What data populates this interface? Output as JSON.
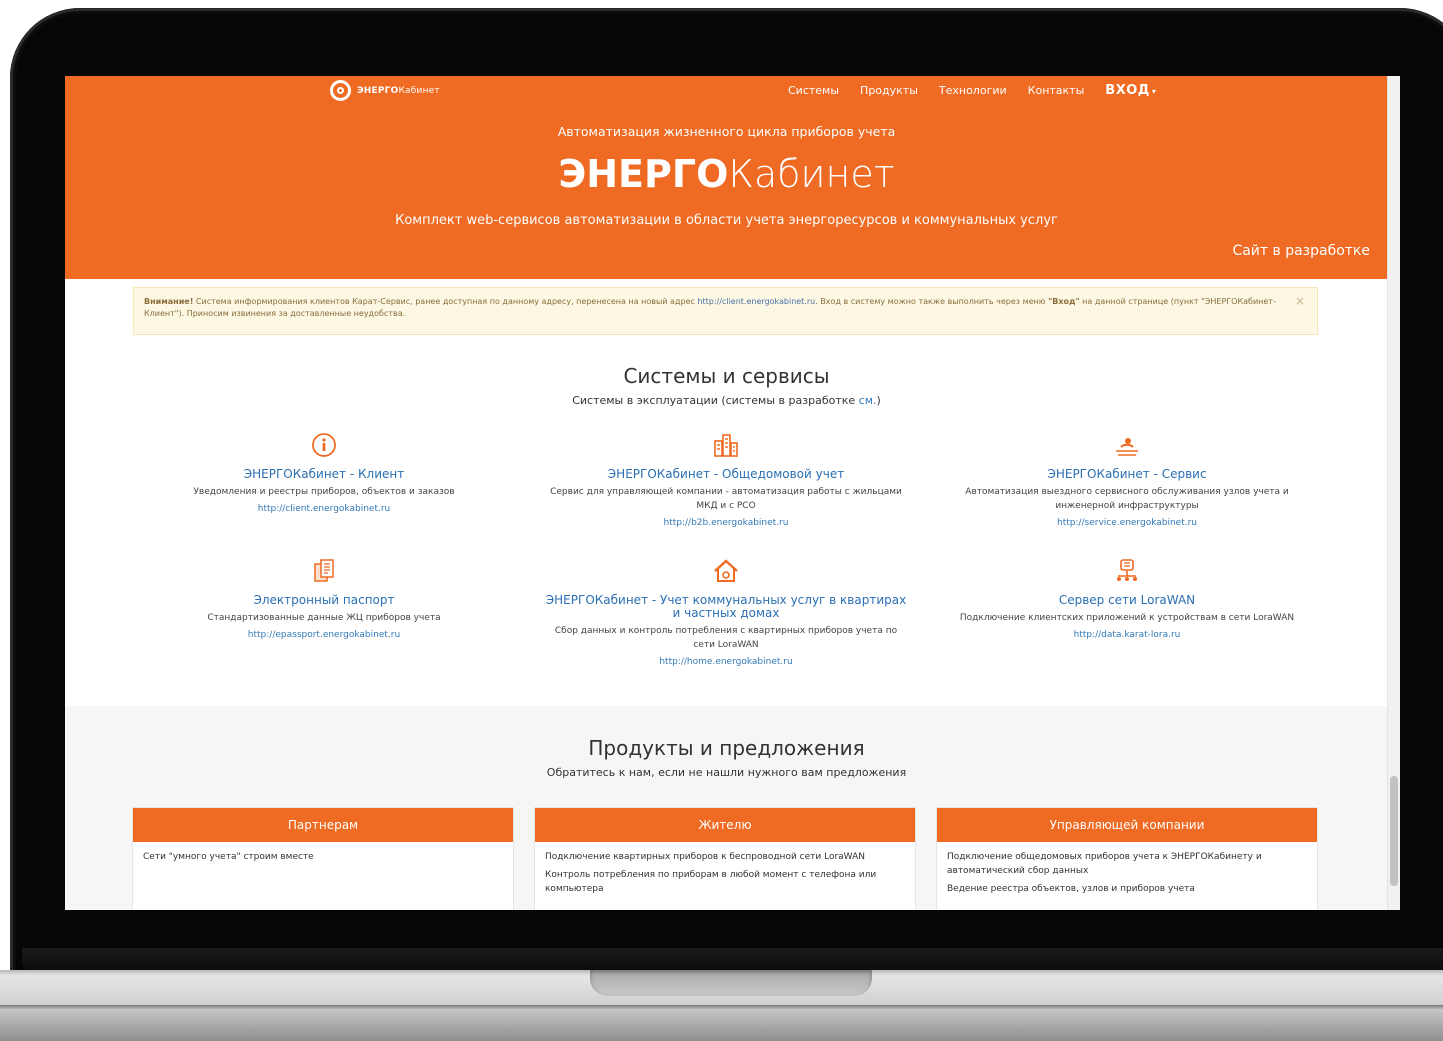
{
  "header": {
    "logo_bold": "ЭНЕРГО",
    "logo_light": "Кабинет",
    "nav": [
      "Системы",
      "Продукты",
      "Технологии",
      "Контакты"
    ],
    "login_label": "ВХОД",
    "tagline": "Автоматизация жизненного цикла приборов учета",
    "brand_bold": "ЭНЕРГО",
    "brand_light": "Кабинет",
    "subtitle": "Комплект web-сервисов автоматизации в области учета энергоресурсов и коммунальных услуг",
    "dev_note": "Сайт в разработке"
  },
  "alert": {
    "strong": "Внимание!",
    "text1": " Система информирования клиентов Карат-Сервис, ранее доступная по данному адресу, перенесена на новый адрес ",
    "link": "http://client.energokabinet.ru",
    "text2": ". Вход в систему можно также выполнить через меню ",
    "menu_label": "\"Вход\"",
    "text3": " на данной странице (пункт \"ЭНЕРГОКабинет-Клиент\"). Приносим извинения за доставленные неудобства.",
    "close": "×"
  },
  "systems": {
    "title": "Системы и сервисы",
    "subtitle_pre": "Системы в эксплуатации (системы в разработке ",
    "subtitle_link": "см.",
    "subtitle_post": ")",
    "cards": [
      {
        "name": "ЭНЕРГОКабинет - Клиент",
        "desc": "Уведомления и реестры приборов, объектов и заказов",
        "link": "http://client.energokabinet.ru",
        "icon": "info-icon"
      },
      {
        "name": "ЭНЕРГОКабинет - Общедомовой учет",
        "desc": "Сервис для управляющей компании - автоматизация работы с жильцами МКД и с РСО",
        "link": "http://b2b.energokabinet.ru",
        "icon": "buildings-icon"
      },
      {
        "name": "ЭНЕРГОКабинет - Сервис",
        "desc": "Автоматизация выездного сервисного обслуживания узлов учета и инженерной инфраструктуры",
        "link": "http://service.energokabinet.ru",
        "icon": "worker-icon"
      },
      {
        "name": "Электронный паспорт",
        "desc": "Стандартизованные данные ЖЦ приборов учета",
        "link": "http://epassport.energokabinet.ru",
        "icon": "documents-icon"
      },
      {
        "name": "ЭНЕРГОКабинет - Учет коммунальных услуг в квартирах и частных домах",
        "desc": "Сбор данных и контроль потребления с квартирных приборов учета по сети LoraWAN",
        "link": "http://home.energokabinet.ru",
        "icon": "house-icon"
      },
      {
        "name": "Сервер сети LoraWAN",
        "desc": "Подключение клиентских приложений к устройствам в сети LoraWAN",
        "link": "http://data.karat-lora.ru",
        "icon": "network-icon"
      }
    ]
  },
  "products": {
    "title": "Продукты и предложения",
    "subtitle": "Обратитесь к нам, если не нашли нужного вам предложения",
    "panels": [
      {
        "head": "Партнерам",
        "items": [
          "Сети \"умного учета\" строим вместе"
        ]
      },
      {
        "head": "Жителю",
        "items": [
          "Подключение квартирных приборов к беспроводной сети LoraWAN",
          "Контроль потребления по приборам в любой момент с телефона или компьютера"
        ]
      },
      {
        "head": "Управляющей компании",
        "items": [
          "Подключение общедомовых приборов учета к ЭНЕРГОКабинету и автоматический сбор данных",
          "Ведение реестра объектов, узлов и приборов учета"
        ]
      }
    ]
  },
  "colors": {
    "accent": "#ef6a22",
    "link": "#337ab7",
    "alert_bg": "#fcf8e3"
  }
}
